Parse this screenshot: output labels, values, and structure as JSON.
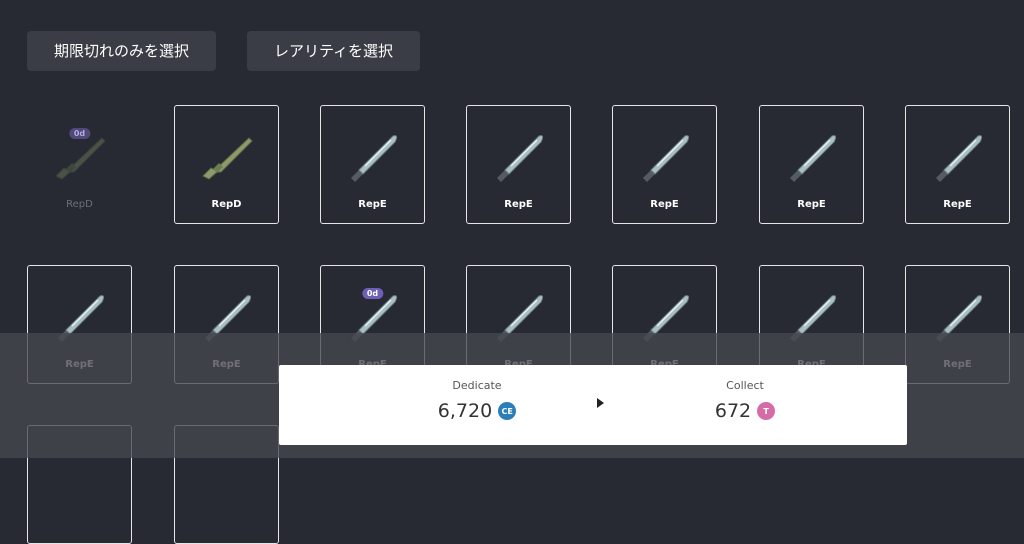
{
  "toolbar": {
    "expired_label": "期限切れのみを選択",
    "rarity_label": "レアリティを選択"
  },
  "items": [
    {
      "label": "RepD",
      "faded": true,
      "badge": "0d",
      "icon": "rifle-icon"
    },
    {
      "label": "RepD",
      "faded": false,
      "badge": "",
      "icon": "rifle-icon"
    },
    {
      "label": "RepE",
      "faded": false,
      "badge": "",
      "icon": "knife-icon"
    },
    {
      "label": "RepE",
      "faded": false,
      "badge": "",
      "icon": "knife-icon"
    },
    {
      "label": "RepE",
      "faded": false,
      "badge": "",
      "icon": "knife-icon"
    },
    {
      "label": "RepE",
      "faded": false,
      "badge": "",
      "icon": "knife-icon"
    },
    {
      "label": "RepE",
      "faded": false,
      "badge": "",
      "icon": "knife-icon"
    },
    {
      "label": "RepE",
      "faded": false,
      "badge": "",
      "icon": "knife-icon"
    },
    {
      "label": "RepE",
      "faded": false,
      "badge": "",
      "icon": "knife-icon"
    },
    {
      "label": "RepE",
      "faded": false,
      "badge": "0d",
      "icon": "knife-icon"
    },
    {
      "label": "RepE",
      "faded": false,
      "badge": "",
      "icon": "knife-icon"
    },
    {
      "label": "RepE",
      "faded": false,
      "badge": "",
      "icon": "knife-icon"
    },
    {
      "label": "RepE",
      "faded": false,
      "badge": "",
      "icon": "knife-icon"
    },
    {
      "label": "RepE",
      "faded": false,
      "badge": "",
      "icon": "knife-icon"
    }
  ],
  "summary": {
    "dedicate_title": "Dedicate",
    "dedicate_value": "6,720",
    "dedicate_currency": "CE",
    "collect_title": "Collect",
    "collect_value": "672",
    "collect_currency": "T"
  }
}
